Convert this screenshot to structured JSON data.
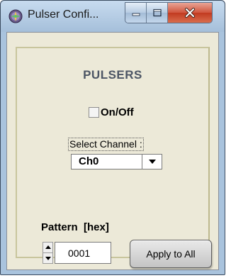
{
  "window": {
    "title": "Pulser Confi...",
    "controls": {
      "minimize_icon": "minimize-icon",
      "maximize_icon": "maximize-icon",
      "close_icon": "close-icon"
    }
  },
  "panel": {
    "heading": "PULSERS",
    "onoff": {
      "label": "On/Off",
      "checked": false
    },
    "channel": {
      "label": "Select Channel :",
      "selected": "Ch0"
    },
    "pattern": {
      "label": "Pattern  [hex]",
      "value": "0001"
    },
    "apply_label": "Apply to All"
  },
  "colors": {
    "titlebar": "#b9cfe6",
    "client_bg": "#ece9d8",
    "group_border": "#c8c59d",
    "heading": "#4c5564",
    "close_button": "#c9432a"
  }
}
